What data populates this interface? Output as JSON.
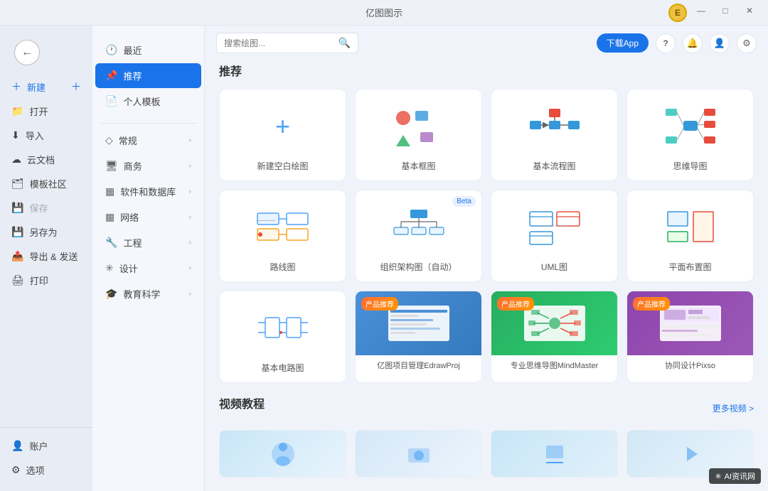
{
  "app": {
    "title": "亿图图示",
    "user_initial": "E"
  },
  "titlebar": {
    "minimize": "—",
    "maximize": "□",
    "close": "✕"
  },
  "toolbar": {
    "download_label": "下载App",
    "search_placeholder": "搜索绘图...",
    "help": "?",
    "notification": "🔔",
    "settings": "⚙"
  },
  "left_nav": {
    "items": [
      {
        "id": "new",
        "label": "新建",
        "icon": "➕"
      },
      {
        "id": "open",
        "label": "打开",
        "icon": "📁"
      },
      {
        "id": "import",
        "label": "导入",
        "icon": "⬇"
      },
      {
        "id": "cloud",
        "label": "云文档",
        "icon": "☁"
      },
      {
        "id": "template",
        "label": "模板社区",
        "icon": "🗂"
      },
      {
        "id": "save",
        "label": "保存",
        "icon": "💾"
      },
      {
        "id": "saveas",
        "label": "另存为",
        "icon": "💾"
      },
      {
        "id": "export",
        "label": "导出 & 发送",
        "icon": "📤"
      },
      {
        "id": "print",
        "label": "打印",
        "icon": "🖨"
      }
    ],
    "bottom": [
      {
        "id": "account",
        "label": "账户",
        "icon": "👤"
      },
      {
        "id": "options",
        "label": "选项",
        "icon": "⚙"
      }
    ]
  },
  "category_nav": {
    "top_items": [
      {
        "id": "recent",
        "label": "最近",
        "icon": "🕐",
        "has_arrow": false
      },
      {
        "id": "recommend",
        "label": "推荐",
        "icon": "📌",
        "has_arrow": false,
        "active": true
      },
      {
        "id": "personal",
        "label": "个人模板",
        "icon": "📄",
        "has_arrow": false
      }
    ],
    "categories": [
      {
        "id": "general",
        "label": "常规",
        "icon": "◇",
        "has_arrow": true
      },
      {
        "id": "business",
        "label": "商务",
        "icon": "🖥",
        "has_arrow": true
      },
      {
        "id": "software_db",
        "label": "软件和数据库",
        "icon": "▦",
        "has_arrow": true
      },
      {
        "id": "network",
        "label": "网络",
        "icon": "▦",
        "has_arrow": true
      },
      {
        "id": "engineering",
        "label": "工程",
        "icon": "🔧",
        "has_arrow": true
      },
      {
        "id": "design",
        "label": "设计",
        "icon": "✳",
        "has_arrow": true
      },
      {
        "id": "education",
        "label": "教育科学",
        "icon": "🎓",
        "has_arrow": true
      }
    ]
  },
  "recommend_section": {
    "title": "推荐",
    "cards": [
      {
        "id": "new_blank",
        "label": "新建空白绘图",
        "type": "new"
      },
      {
        "id": "basic_frame",
        "label": "基本框图",
        "type": "frame"
      },
      {
        "id": "basic_flow",
        "label": "基本流程图",
        "type": "flow"
      },
      {
        "id": "mind_map",
        "label": "思维导图",
        "type": "mind"
      },
      {
        "id": "route",
        "label": "路线图",
        "type": "route",
        "badge": null
      },
      {
        "id": "org_chart",
        "label": "组织架构图（自动）",
        "type": "org",
        "badge": "Beta"
      },
      {
        "id": "uml",
        "label": "UML图",
        "type": "uml"
      },
      {
        "id": "floor_plan",
        "label": "平面布置图",
        "type": "floor"
      },
      {
        "id": "circuit",
        "label": "基本电路图",
        "type": "circuit"
      },
      {
        "id": "edraw_proj",
        "label": "亿图项目管理EdrawProj",
        "type": "product",
        "badge": "产品推荐",
        "bg": "#3a7bd5"
      },
      {
        "id": "mindmaster",
        "label": "专业思维导图MindMaster",
        "type": "product",
        "badge": "产品推荐",
        "bg": "#2ecc71"
      },
      {
        "id": "pixso",
        "label": "协同设计Pixso",
        "type": "product",
        "badge": "产品推荐",
        "bg": "#9b59b6"
      }
    ]
  },
  "video_section": {
    "title": "视频教程",
    "more_label": "更多视频 >",
    "videos": [
      {
        "id": "v1",
        "thumb_color": "#c8e6f7"
      },
      {
        "id": "v2",
        "thumb_color": "#c8e6f7"
      },
      {
        "id": "v3",
        "thumb_color": "#c8e6f7"
      },
      {
        "id": "v4",
        "thumb_color": "#c8e6f7"
      }
    ]
  },
  "watermark": {
    "text": "AI资讯网",
    "icon": "✳"
  }
}
